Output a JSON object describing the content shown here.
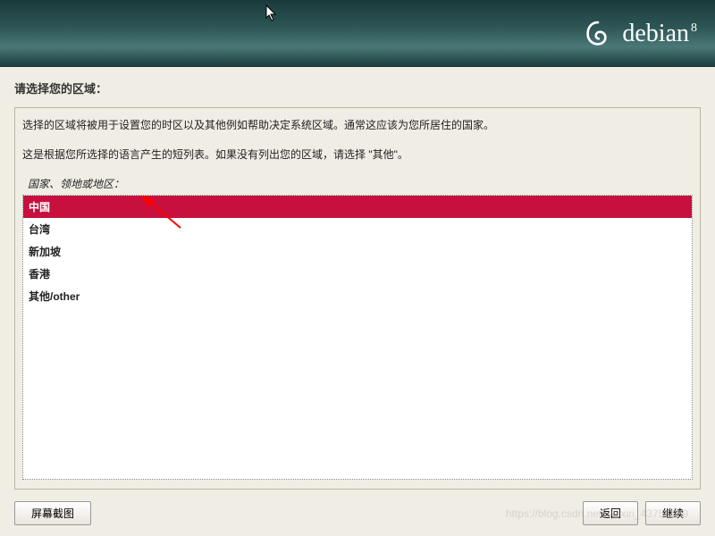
{
  "header": {
    "brand": "debian",
    "version": "8"
  },
  "page": {
    "title": "请选择您的区域：",
    "description_line1": "选择的区域将被用于设置您的时区以及其他例如帮助决定系统区域。通常这应该为您所居住的国家。",
    "description_line2": "这是根据您所选择的语言产生的短列表。如果没有列出您的区域，请选择 \"其他\"。",
    "list_label": "国家、领地或地区："
  },
  "regions": [
    {
      "label": "中国",
      "selected": true
    },
    {
      "label": "台湾",
      "selected": false
    },
    {
      "label": "新加坡",
      "selected": false
    },
    {
      "label": "香港",
      "selected": false
    },
    {
      "label": "其他/other",
      "selected": false
    }
  ],
  "buttons": {
    "screenshot": "屏幕截图",
    "back": "返回",
    "continue": "继续"
  },
  "colors": {
    "accent": "#c8103f",
    "banner_dark": "#1a3a3a",
    "panel_bg": "#f0ede4"
  },
  "watermark": "https://blog.csdn.net/weixin_43756369"
}
